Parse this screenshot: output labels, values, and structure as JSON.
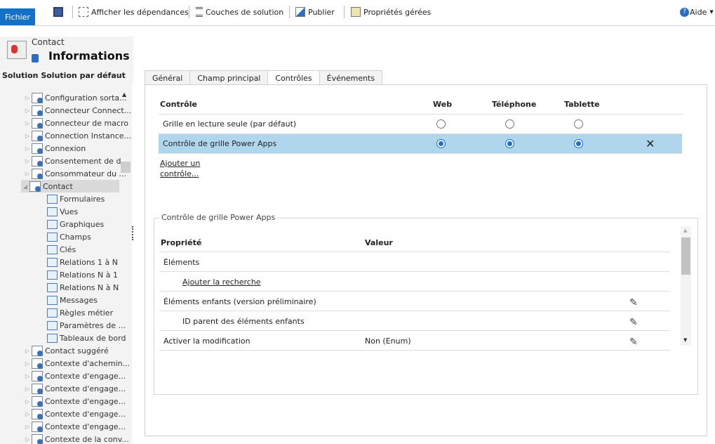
{
  "toolbar": {
    "file": "Fichier",
    "save_icon": "save-icon",
    "dependencies": "Afficher les dépendances",
    "layers": "Couches de solution",
    "publish": "Publier",
    "managed": "Propriétés gérées",
    "help": "Aide"
  },
  "header": {
    "entity": "Contact",
    "title": "Informations"
  },
  "solution": "Solution Solution par défaut",
  "tree": {
    "items_before": [
      "Configuration sorta...",
      "Connecteur Connect...",
      "Connecteur de macro",
      "Connection Instance...",
      "Connexion",
      "Consentement de d...",
      "Consommateur du ..."
    ],
    "selected": "Contact",
    "children": [
      "Formulaires",
      "Vues",
      "Graphiques",
      "Champs",
      "Clés",
      "Relations 1 à N",
      "Relations N à 1",
      "Relations N à N",
      "Messages",
      "Règles métier",
      "Paramètres de ...",
      "Tableaux de bord"
    ],
    "items_after": [
      "Contact suggéré",
      "Contexte d'achemin...",
      "Contexte d'engage...",
      "Contexte d'engage...",
      "Contexte d'engage...",
      "Contexte d'engage...",
      "Contexte d'engage...",
      "Contexte de la conv..."
    ]
  },
  "tabs": [
    "Général",
    "Champ principal",
    "Contrôles",
    "Événements"
  ],
  "active_tab": "Contrôles",
  "controls": {
    "headers": [
      "Contrôle",
      "Web",
      "Téléphone",
      "Tablette"
    ],
    "rows": [
      {
        "name": "Grille en lecture seule (par défaut)",
        "web": false,
        "phone": false,
        "tablet": false
      },
      {
        "name": "Contrôle de grille Power Apps",
        "web": true,
        "phone": true,
        "tablet": true,
        "selected": true
      }
    ],
    "add_link": "Ajouter un contrôle...",
    "selected_color": "#b0d6ee"
  },
  "properties": {
    "legend": "Contrôle de grille Power Apps",
    "headers": [
      "Propriété",
      "Valeur"
    ],
    "rows": [
      {
        "name": "Éléments",
        "value": "",
        "edit": false
      },
      {
        "name": "Ajouter la recherche",
        "value": "",
        "edit": false,
        "link": true,
        "indent": true
      },
      {
        "name": "Éléments enfants (version préliminaire)",
        "value": "",
        "edit": true
      },
      {
        "name": "ID parent des éléments enfants",
        "value": "",
        "edit": true,
        "indent": true
      },
      {
        "name": "Activer la modification",
        "value": "Non (Enum)",
        "edit": true
      }
    ]
  }
}
